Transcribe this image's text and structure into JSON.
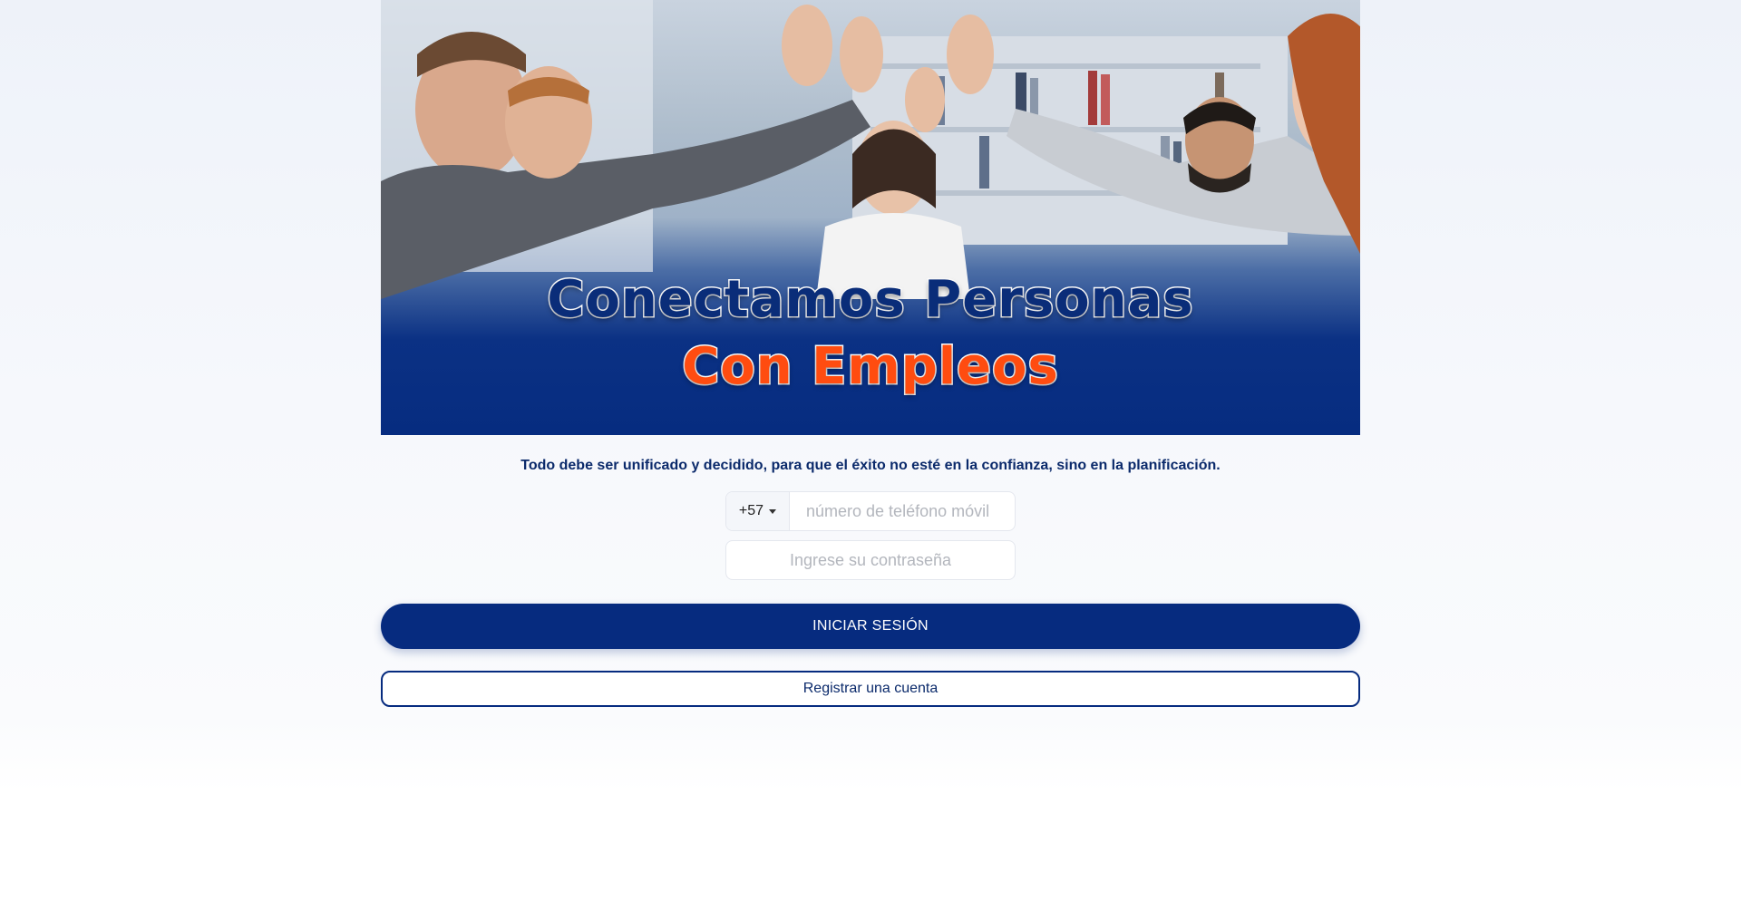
{
  "hero": {
    "line1": "Conectamos Personas",
    "line2": "Con Empleos"
  },
  "tagline": "Todo debe ser unificado y decidido, para que el éxito no esté en la confianza, sino en la planificación.",
  "form": {
    "country_code": "+57",
    "phone_placeholder": "número de teléfono móvil",
    "password_placeholder": "Ingrese su contraseña"
  },
  "buttons": {
    "login_label": "INICIAR SESIÓN",
    "register_label": "Registrar una cuenta"
  },
  "colors": {
    "brand_blue": "#062b7f",
    "accent_orange": "#ff4c10"
  }
}
